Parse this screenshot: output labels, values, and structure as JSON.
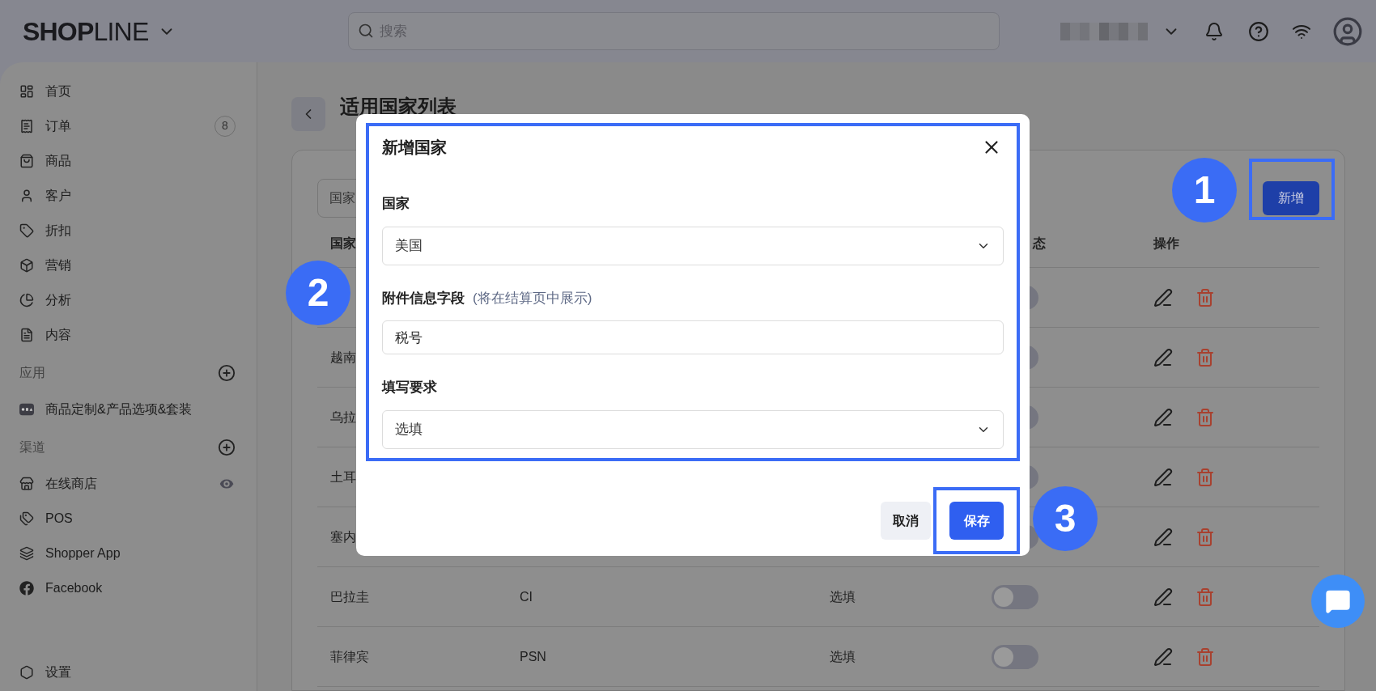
{
  "header": {
    "logo": "**SHOP**LINE",
    "search": {
      "placeholder": "搜索"
    }
  },
  "sidebar": {
    "items": [
      {
        "label": "首页"
      },
      {
        "label": "订单",
        "count": "8"
      },
      {
        "label": "商品"
      },
      {
        "label": "客户"
      },
      {
        "label": "折扣"
      },
      {
        "label": "营销"
      },
      {
        "label": "分析"
      },
      {
        "label": "内容"
      }
    ],
    "sections": [
      {
        "title": "应用",
        "items": [
          {
            "label": "商品定制&产品选项&套装"
          }
        ]
      },
      {
        "title": "渠道",
        "items": [
          {
            "label": "在线商店",
            "visible": true
          },
          {
            "label": "POS"
          },
          {
            "label": "Shopper App"
          },
          {
            "label": "Facebook"
          }
        ]
      }
    ],
    "footer_item": {
      "label": "设置"
    }
  },
  "page": {
    "title": "适用国家列表",
    "filter": {
      "placeholder": "国家"
    },
    "add_button": "新增",
    "table": {
      "columns": [
        "国家",
        "态",
        "操作"
      ],
      "rows": [
        {
          "enabled": false
        },
        {
          "country": "越南",
          "enabled": false
        },
        {
          "country": "乌拉",
          "enabled": false
        },
        {
          "country": "土耳",
          "enabled": false
        },
        {
          "country": "塞内",
          "enabled": false
        },
        {
          "country": "巴拉圭",
          "field": "CI",
          "requirement": "选填",
          "enabled": false
        },
        {
          "country": "菲律宾",
          "field": "PSN",
          "requirement": "选填",
          "enabled": false
        }
      ]
    }
  },
  "dialog": {
    "title": "新增国家",
    "fields": [
      {
        "kind": "select",
        "label": "国家",
        "value": "美国"
      },
      {
        "kind": "input",
        "label": "附件信息字段",
        "hint": "(将在结算页中展示)",
        "value": "税号"
      },
      {
        "kind": "select",
        "label": "填写要求",
        "value": "选填"
      }
    ],
    "cancel": "取消",
    "save": "保存"
  },
  "callouts": [
    "1",
    "2",
    "3"
  ]
}
